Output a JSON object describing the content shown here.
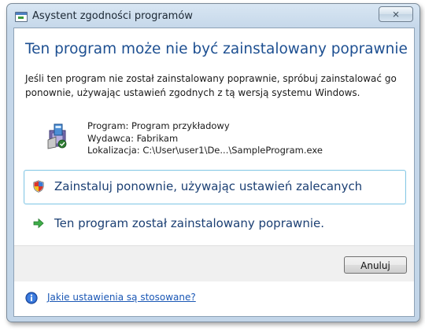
{
  "window": {
    "title": "Asystent zgodności programów",
    "close_label": "⨯"
  },
  "main": {
    "heading": "Ten program może nie być zainstalowany poprawnie",
    "description": "Jeśli ten program nie został zainstalowany poprawnie, spróbuj zainstalować go ponownie, używając ustawień zgodnych z tą wersją systemu Windows.",
    "program": {
      "icon": "installer-package-icon",
      "line_program": "Program: Program przykładowy",
      "line_publisher": "Wydawca: Fabrikam",
      "line_location": "Lokalizacja: C:\\User\\user1\\De...\\SampleProgram.exe"
    },
    "options": [
      {
        "label": "Zainstaluj ponownie, używając ustawień zalecanych",
        "icon": "shield-icon",
        "selected": true
      },
      {
        "label": "Ten program został zainstalowany poprawnie.",
        "icon": "green-arrow-icon",
        "selected": false
      }
    ]
  },
  "footer": {
    "cancel_label": "Anuluj",
    "help_link": "Jakie ustawienia są stosowane?",
    "help_icon": "info-icon"
  },
  "colors": {
    "heading": "#1d4f91",
    "link": "#1a57b5",
    "selection_border": "#86c8e6"
  }
}
